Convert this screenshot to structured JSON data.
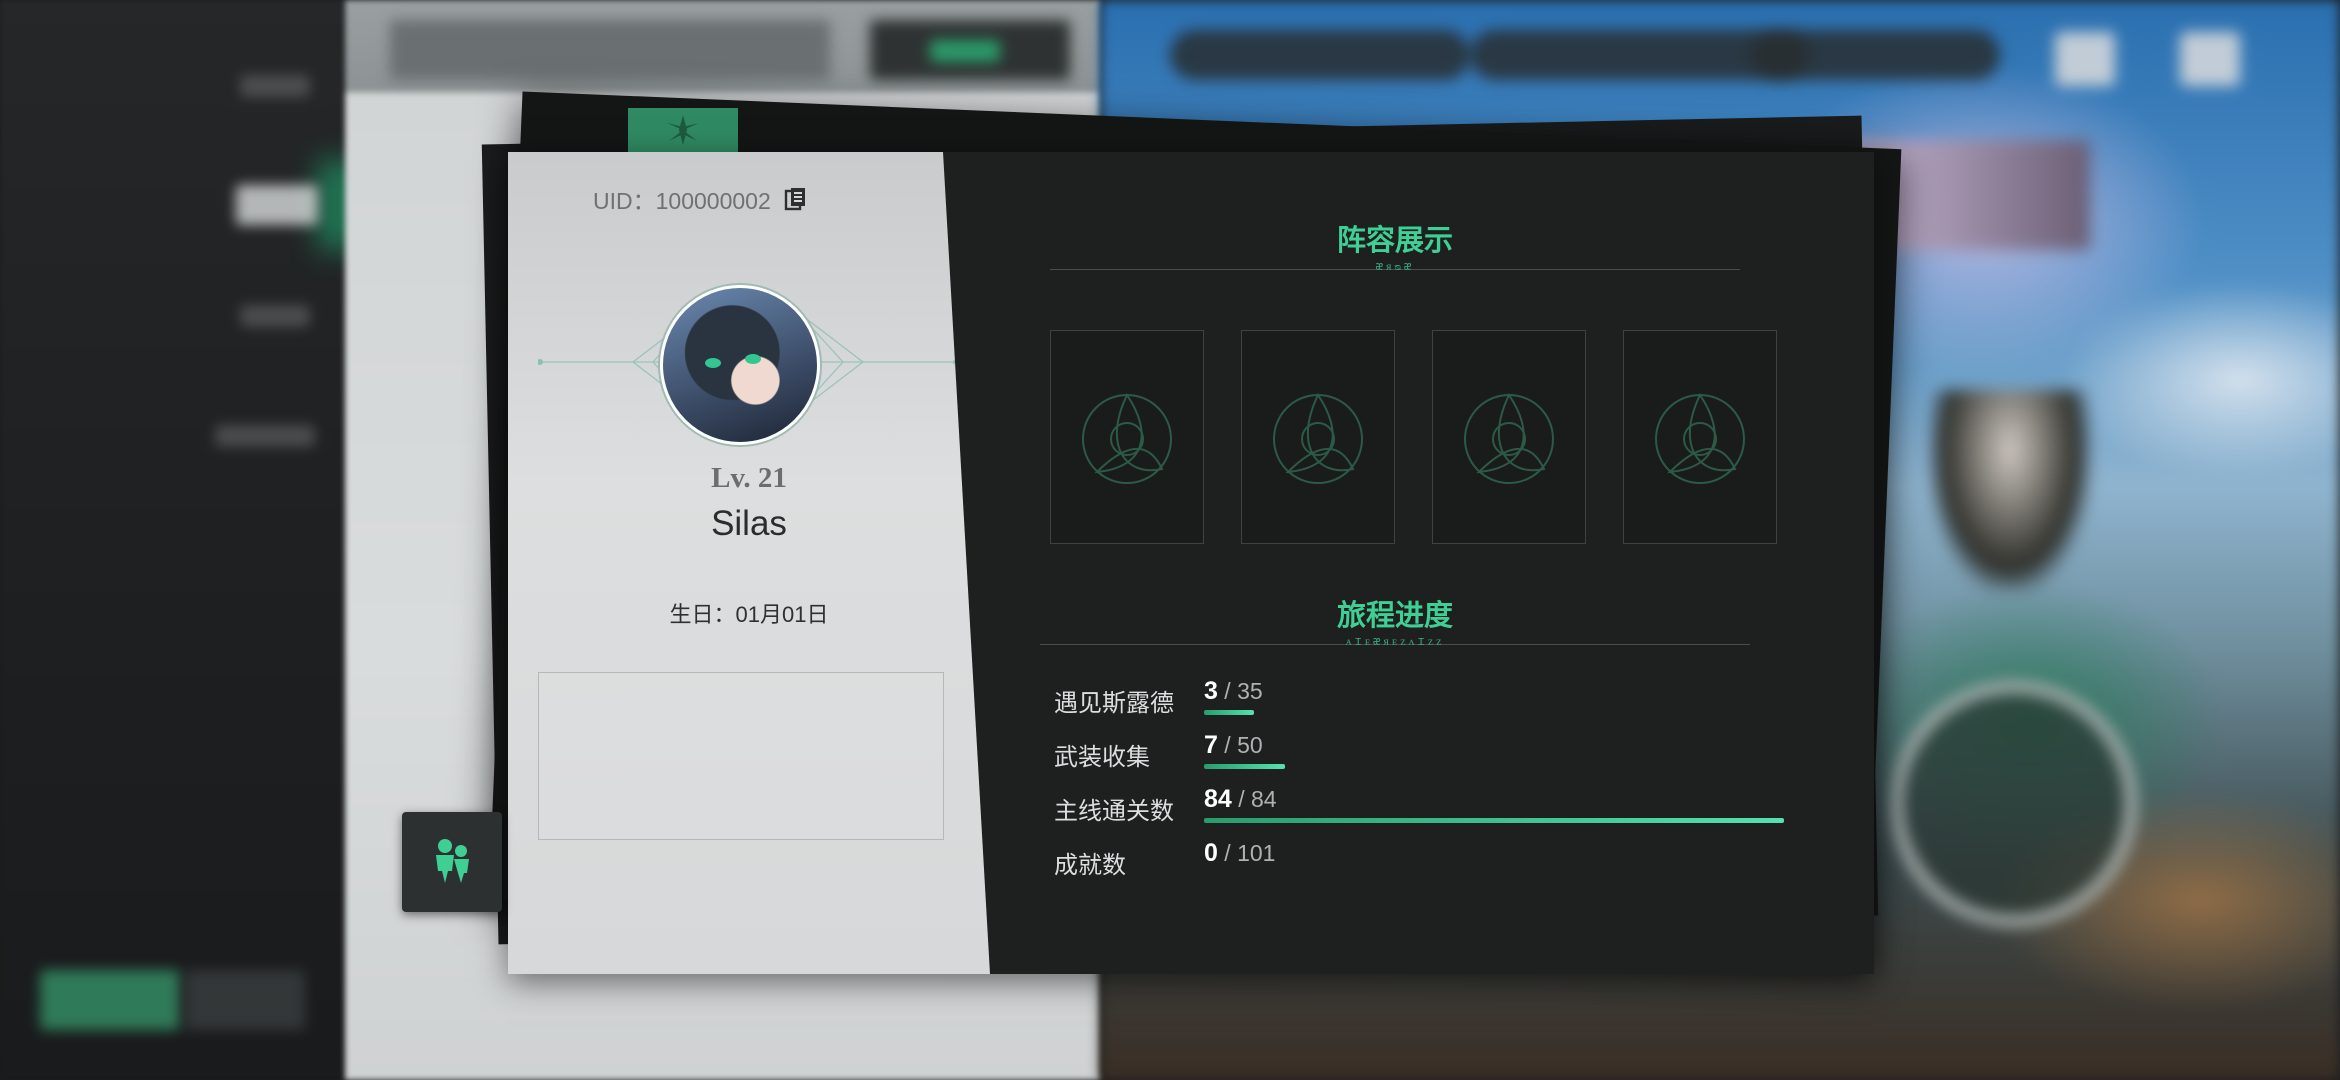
{
  "profile": {
    "uid_label": "UID：100000002",
    "level_label": "Lv. 21",
    "name": "Silas",
    "birthday_label": "生日：01月01日"
  },
  "lineup": {
    "title": "阵容展示",
    "rune": "ᴂᴙᴓᴂ",
    "slots": 4
  },
  "journey": {
    "title": "旅程进度",
    "rune": "ᴀɪᴇᴂᴙᴇᴢᴧɪᴢᴢ",
    "items": [
      {
        "label": "遇见斯露德",
        "current": "3",
        "total": "/ 35",
        "progress": 0.086
      },
      {
        "label": "武装收集",
        "current": "7",
        "total": "/ 50",
        "progress": 0.14
      },
      {
        "label": "主线通关数",
        "current": "84",
        "total": "/ 84",
        "progress": 1.0
      },
      {
        "label": "成就数",
        "current": "0",
        "total": "/ 101",
        "progress": 0.0
      }
    ]
  },
  "icons": {
    "copy": "copy-icon",
    "friends": "friends-icon",
    "slot_emblem": "triquetra-emblem-icon",
    "tab_emblem": "leaf-emblem-icon"
  },
  "colors": {
    "accent_green": "#3fcf94",
    "card_dark": "#1e1f1f",
    "card_light": "#d6d8d9"
  }
}
